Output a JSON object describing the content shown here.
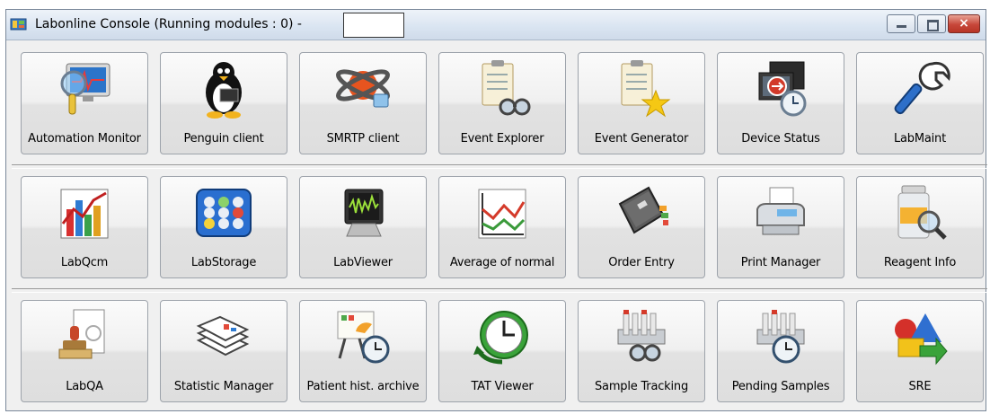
{
  "window": {
    "title": "Labonline Console (Running modules : 0) -",
    "controls": {
      "minimize": "minimize",
      "maximize": "maximize",
      "close": "×"
    }
  },
  "rows": [
    [
      {
        "label": "Automation Monitor",
        "icon": "automation-monitor-icon"
      },
      {
        "label": "Penguin client",
        "icon": "penguin-icon"
      },
      {
        "label": "SMRTP client",
        "icon": "smrtp-icon"
      },
      {
        "label": "Event Explorer",
        "icon": "event-explorer-icon"
      },
      {
        "label": "Event Generator",
        "icon": "event-generator-icon"
      },
      {
        "label": "Device Status",
        "icon": "device-status-icon"
      },
      {
        "label": "LabMaint",
        "icon": "wrench-icon"
      }
    ],
    [
      {
        "label": "LabQcm",
        "icon": "bar-chart-icon"
      },
      {
        "label": "LabStorage",
        "icon": "storage-rack-icon"
      },
      {
        "label": "LabViewer",
        "icon": "monitor-waveform-icon"
      },
      {
        "label": "Average of normal",
        "icon": "line-chart-icon"
      },
      {
        "label": "Order Entry",
        "icon": "notebook-icon"
      },
      {
        "label": "Print Manager",
        "icon": "printer-icon"
      },
      {
        "label": "Reagent Info",
        "icon": "reagent-bottle-icon"
      }
    ],
    [
      {
        "label": "LabQA",
        "icon": "stamp-document-icon"
      },
      {
        "label": "Statistic Manager",
        "icon": "stacked-reports-icon"
      },
      {
        "label": "Patient hist. archive",
        "icon": "archive-clock-icon"
      },
      {
        "label": "TAT Viewer",
        "icon": "clock-icon"
      },
      {
        "label": "Sample Tracking",
        "icon": "sample-tracking-icon"
      },
      {
        "label": "Pending Samples",
        "icon": "pending-samples-icon"
      },
      {
        "label": "SRE",
        "icon": "shapes-icon"
      }
    ]
  ],
  "colors": {
    "titlebar": "#d9e4f1",
    "button_face": "#f0f0f0",
    "close_button": "#c7473a"
  }
}
